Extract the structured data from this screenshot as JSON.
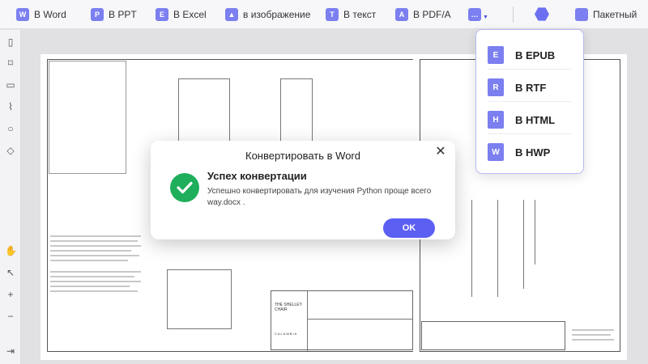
{
  "toolbar": {
    "items": [
      {
        "label": "В Word",
        "icon": "W",
        "icon_name": "word-icon"
      },
      {
        "label": "В PPT",
        "icon": "P",
        "icon_name": "ppt-icon"
      },
      {
        "label": "В Excel",
        "icon": "E",
        "icon_name": "excel-icon"
      },
      {
        "label": "в изображение",
        "icon": "▲",
        "icon_name": "image-icon"
      },
      {
        "label": "В текст",
        "icon": "T",
        "icon_name": "text-icon"
      },
      {
        "label": "В PDF/A",
        "icon": "A",
        "icon_name": "pdfa-icon"
      }
    ],
    "more_icon": "…",
    "batch_label": "Пакетный"
  },
  "dropdown": {
    "items": [
      {
        "label": "В EPUB",
        "icon": "E"
      },
      {
        "label": "В RTF",
        "icon": "R"
      },
      {
        "label": "В HTML",
        "icon": "H"
      },
      {
        "label": "В HWP",
        "icon": "W"
      }
    ]
  },
  "dialog": {
    "title": "Конвертировать в Word",
    "heading": "Успех конвертации",
    "message": "Успешно конвертировать для изучения Python проще всего way.docx .",
    "ok_label": "OK",
    "close_icon": "✕"
  },
  "document": {
    "title_block_1": "THE SHELLEY CHAIR",
    "brand": "CALAMBIA"
  },
  "colors": {
    "accent": "#5b5ff2",
    "success": "#1fae5b"
  }
}
